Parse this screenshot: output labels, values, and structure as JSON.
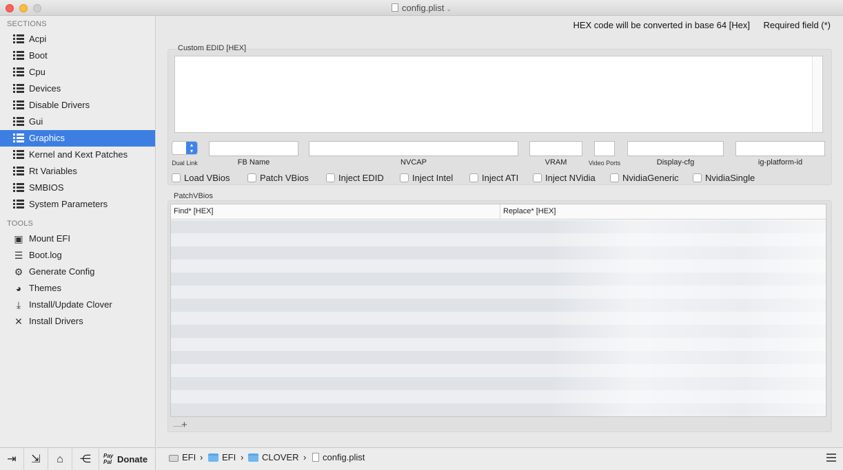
{
  "window": {
    "title": "config.plist"
  },
  "sidebar": {
    "sections_header": "SECTIONS",
    "sections": [
      {
        "label": "Acpi"
      },
      {
        "label": "Boot"
      },
      {
        "label": "Cpu"
      },
      {
        "label": "Devices"
      },
      {
        "label": "Disable Drivers"
      },
      {
        "label": "Gui"
      },
      {
        "label": "Graphics",
        "selected": true
      },
      {
        "label": "Kernel and Kext Patches"
      },
      {
        "label": "Rt Variables"
      },
      {
        "label": "SMBIOS"
      },
      {
        "label": "System Parameters"
      }
    ],
    "tools_header": "TOOLS",
    "tools": [
      {
        "label": "Mount EFI",
        "icon": "disk-icon"
      },
      {
        "label": "Boot.log",
        "icon": "log-icon"
      },
      {
        "label": "Generate Config",
        "icon": "gears-icon"
      },
      {
        "label": "Themes",
        "icon": "palette-icon"
      },
      {
        "label": "Install/Update Clover",
        "icon": "download-icon"
      },
      {
        "label": "Install Drivers",
        "icon": "tools-icon"
      }
    ],
    "bottom": {
      "donate_logo_line1": "Pay",
      "donate_logo_line2": "Pal",
      "donate_label": "Donate"
    }
  },
  "main": {
    "hex_note": "HEX code will be converted in base 64 [Hex]",
    "required_note": "Required field (*)",
    "edid_title": "Custom EDID [HEX]",
    "edid_value": "",
    "fields": {
      "dual_link": "Dual Link",
      "fb_name": "FB Name",
      "nvcap": "NVCAP",
      "vram": "VRAM",
      "video_ports": "Video Ports",
      "display_cfg": "Display-cfg",
      "ig_platform_id": "ig-platform-id"
    },
    "checkboxes": {
      "load_vbios": "Load VBios",
      "patch_vbios": "Patch VBios",
      "inject_edid": "Inject EDID",
      "inject_intel": "Inject Intel",
      "inject_ati": "Inject ATI",
      "inject_nvidia": "Inject NVidia",
      "nvidia_generic": "NvidiaGeneric",
      "nvidia_single": "NvidiaSingle"
    },
    "patch_title": "PatchVBios",
    "patch_columns": {
      "find": "Find* [HEX]",
      "replace": "Replace* [HEX]"
    },
    "table_controls": {
      "minus": "—",
      "plus": "+"
    }
  },
  "pathbar": {
    "crumbs": [
      "EFI",
      "EFI",
      "CLOVER",
      "config.plist"
    ],
    "separator": "›"
  },
  "colors": {
    "accent": "#3d7ee3",
    "close": "#fc605b",
    "minimize": "#fdbc40"
  }
}
